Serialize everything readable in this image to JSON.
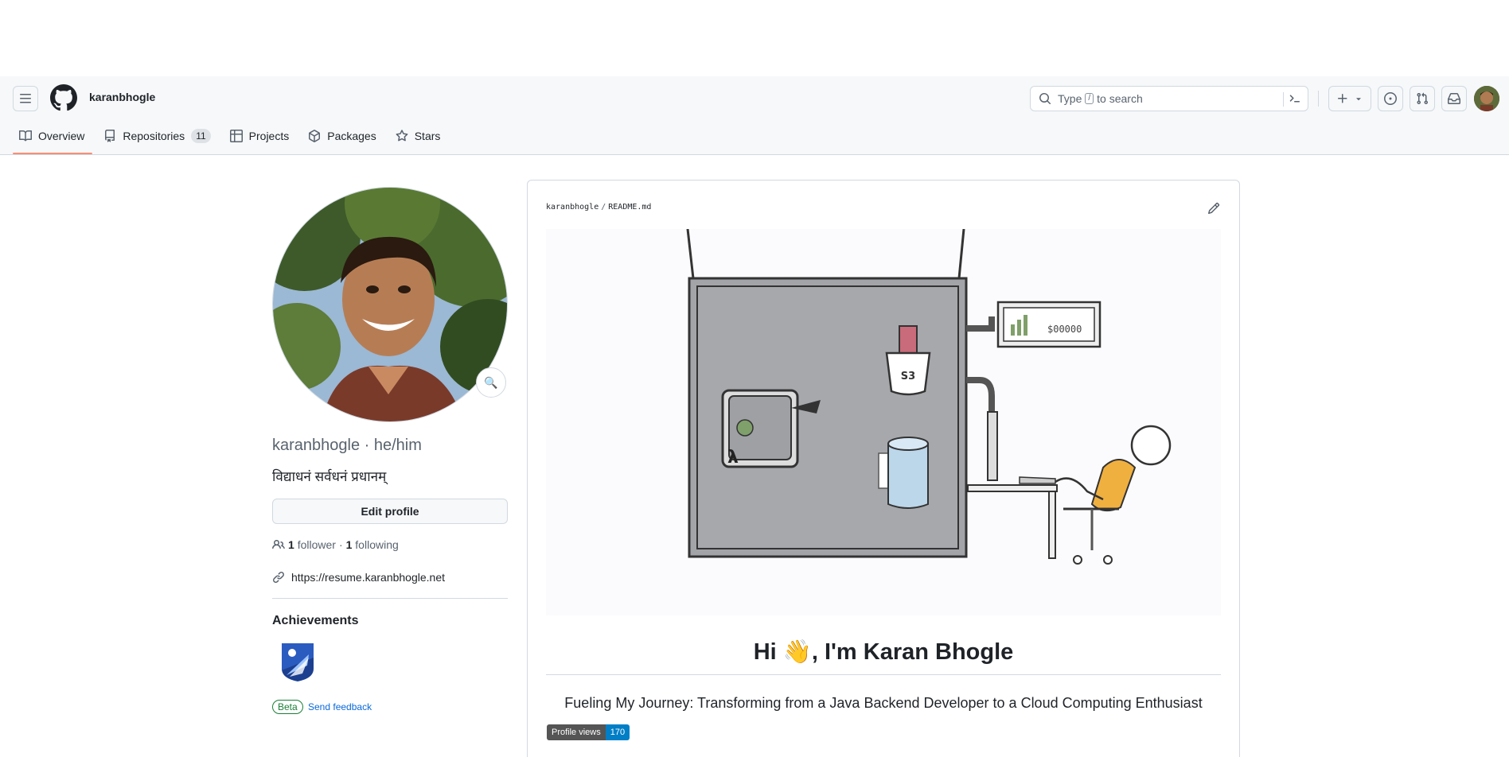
{
  "header": {
    "owner": "karanbhogle",
    "search_placeholder_pre": "Type",
    "search_placeholder_key": "/",
    "search_placeholder_post": "to search"
  },
  "tabs": [
    {
      "label": "Overview",
      "icon": "book-icon"
    },
    {
      "label": "Repositories",
      "icon": "repo-icon",
      "count": "11"
    },
    {
      "label": "Projects",
      "icon": "table-icon"
    },
    {
      "label": "Packages",
      "icon": "package-icon"
    },
    {
      "label": "Stars",
      "icon": "star-icon"
    }
  ],
  "profile": {
    "login": "karanbhogle",
    "pronouns": "he/him",
    "name_line": "karanbhogle · he/him",
    "bio": "विद्याधनं सर्वधनं प्रधानम्",
    "edit_label": "Edit profile",
    "followers_count": "1",
    "followers_label": "follower",
    "dot": "·",
    "following_count": "1",
    "following_label": "following",
    "website": "https://resume.karanbhogle.net",
    "achievements_title": "Achievements",
    "beta_label": "Beta",
    "feedback_label": "Send feedback"
  },
  "readme": {
    "owner": "karanbhogle",
    "sep": "/",
    "file": "README.md",
    "heading": "Hi 👋, I'm Karan Bhogle",
    "tagline": "Fueling My Journey: Transforming from a Java Backend Developer to a Cloud Computing Enthusiast",
    "views_label": "Profile views",
    "views_count": "170",
    "illustration_s3_label": "S3",
    "illustration_dollar_label": "$00000"
  },
  "colors": {
    "tab_underline": "#fd8c73",
    "link": "#0969da",
    "beta": "#1a7f37",
    "badge_left": "#555555",
    "badge_right": "#007ec6"
  }
}
